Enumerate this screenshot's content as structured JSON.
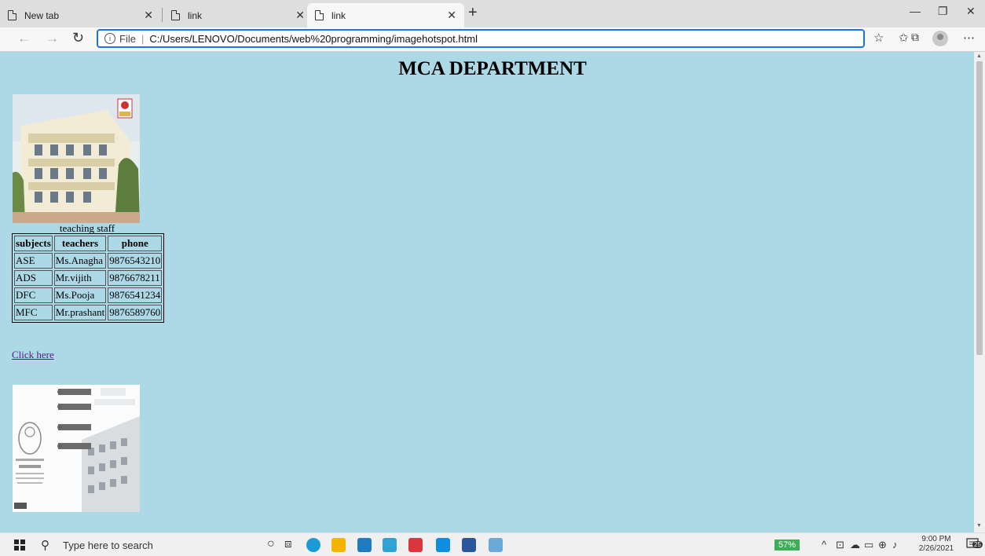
{
  "browser": {
    "tabs": [
      {
        "label": "New tab"
      },
      {
        "label": "link"
      },
      {
        "label": "link"
      }
    ],
    "address": {
      "file_label": "File",
      "separator": "|",
      "url": "C:/Users/LENOVO/Documents/web%20programming/imagehotspot.html"
    },
    "accent_color": "#1a73e8"
  },
  "page": {
    "background": "#add8e6",
    "heading": "MCA DEPARTMENT",
    "caption": "teaching staff",
    "table": {
      "headers": [
        "subjects",
        "teachers",
        "phone"
      ],
      "rows": [
        [
          "ASE",
          "Ms.Anagha",
          "9876543210"
        ],
        [
          "ADS",
          "Mr.vijith",
          "9876678211"
        ],
        [
          "DFC",
          "Ms.Pooja",
          "9876541234"
        ],
        [
          "MFC",
          "Mr.prashant",
          "9876589760"
        ]
      ]
    },
    "link_text": "Click here"
  },
  "taskbar": {
    "search_placeholder": "Type here to search",
    "battery": "57%",
    "time": "9:00 PM",
    "date": "2/26/2021",
    "notifications": "25"
  }
}
